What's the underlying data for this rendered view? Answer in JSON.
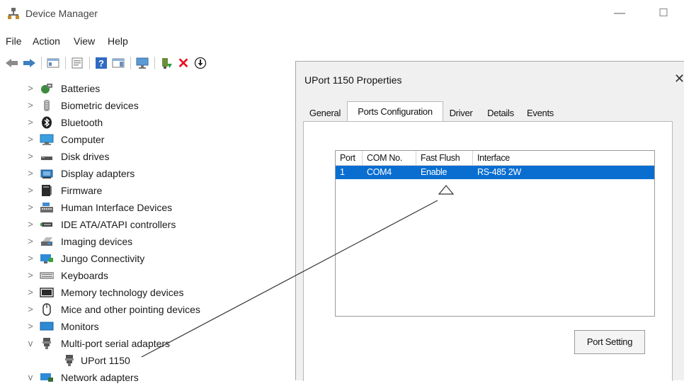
{
  "window": {
    "title": "Device Manager",
    "minimize_glyph": "—",
    "maximize_glyph": "☐"
  },
  "menu": [
    "File",
    "Action",
    "View",
    "Help"
  ],
  "toolbar": {
    "icons": [
      "back-arrow-icon",
      "forward-arrow-icon",
      "show-hide-console-tree-icon",
      "properties-icon",
      "help-icon",
      "action-pane-icon",
      "computer-scan-icon",
      "update-driver-icon",
      "uninstall-device-icon",
      "disable-device-icon"
    ],
    "uninstall_glyph": "✕"
  },
  "tree": {
    "items": [
      {
        "label": "Batteries",
        "icon": "batteries-icon",
        "expanded": false
      },
      {
        "label": "Biometric devices",
        "icon": "biometric-icon",
        "expanded": false
      },
      {
        "label": "Bluetooth",
        "icon": "bluetooth-icon",
        "expanded": false
      },
      {
        "label": "Computer",
        "icon": "computer-icon",
        "expanded": false
      },
      {
        "label": "Disk drives",
        "icon": "disk-drive-icon",
        "expanded": false
      },
      {
        "label": "Display adapters",
        "icon": "display-adapter-icon",
        "expanded": false
      },
      {
        "label": "Firmware",
        "icon": "firmware-icon",
        "expanded": false
      },
      {
        "label": "Human Interface Devices",
        "icon": "hid-icon",
        "expanded": false
      },
      {
        "label": "IDE ATA/ATAPI controllers",
        "icon": "ide-controller-icon",
        "expanded": false
      },
      {
        "label": "Imaging devices",
        "icon": "imaging-device-icon",
        "expanded": false
      },
      {
        "label": "Jungo Connectivity",
        "icon": "jungo-icon",
        "expanded": false
      },
      {
        "label": "Keyboards",
        "icon": "keyboard-icon",
        "expanded": false
      },
      {
        "label": "Memory technology devices",
        "icon": "memory-device-icon",
        "expanded": false
      },
      {
        "label": "Mice and other pointing devices",
        "icon": "mouse-icon",
        "expanded": false
      },
      {
        "label": "Monitors",
        "icon": "monitor-icon",
        "expanded": false
      },
      {
        "label": "Multi-port serial adapters",
        "icon": "serial-adapter-icon",
        "expanded": true
      },
      {
        "label": "UPort 1150",
        "icon": "serial-adapter-icon",
        "child": true
      },
      {
        "label": "Network adapters",
        "icon": "network-adapter-icon",
        "expanded": true
      }
    ],
    "chevron_collapsed": ">",
    "chevron_expanded": "v"
  },
  "dialog": {
    "title": "UPort 1150 Properties",
    "close_glyph": "✕",
    "tabs": [
      "General",
      "Ports Configuration",
      "Driver",
      "Details",
      "Events"
    ],
    "active_tab": "Ports Configuration",
    "table": {
      "columns": [
        "Port",
        "COM No.",
        "Fast Flush",
        "Interface"
      ],
      "rows": [
        [
          "1",
          "COM4",
          "Enable",
          "RS-485 2W"
        ]
      ]
    },
    "port_setting_button": "Port Setting"
  },
  "colors": {
    "selection": "#0a6ed1",
    "dialog_bg": "#f0f0f0",
    "uninstall_red": "#e81123"
  }
}
